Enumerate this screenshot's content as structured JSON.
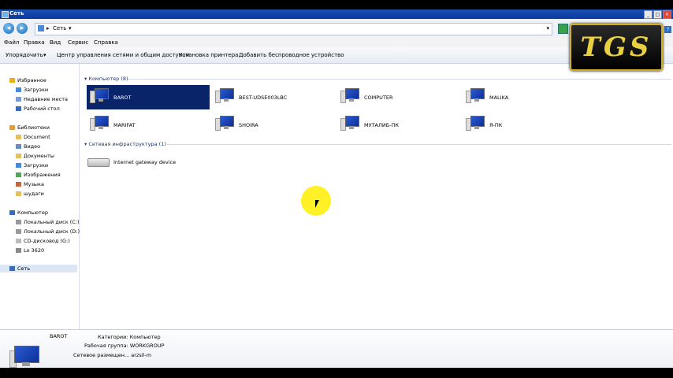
{
  "window": {
    "title": "Сеть"
  },
  "address": {
    "path_root": "Сеть",
    "path_chevron": "▸",
    "dropdown": "▾"
  },
  "menu": [
    "Файл",
    "Правка",
    "Вид",
    "Сервис",
    "Справка"
  ],
  "toolbar": {
    "organize": "Упорядочить",
    "organize_arrow": "▾",
    "items": [
      "Центр управления сетями и общим доступом",
      "Установка принтера",
      "Добавить беспроводное устройство"
    ]
  },
  "sidebar": {
    "favorites": {
      "title": "Избранное",
      "items": [
        "Загрузки",
        "Недавние места",
        "Рабочий стол"
      ]
    },
    "libraries": {
      "title": "Библиотеки",
      "items": [
        "Document",
        "Видео",
        "Документы",
        "Загрузки",
        "Изображения",
        "Музыка",
        "шудаги"
      ]
    },
    "computer": {
      "title": "Компьютер",
      "items": [
        "Локальный диск (C:)",
        "Локальный диск (D:)",
        "CD-дисковод (G:)",
        "Lo 3620"
      ]
    },
    "network": {
      "title": "Сеть"
    }
  },
  "groups": {
    "computers": {
      "title": "Компьютер (8)",
      "items": [
        "BAROT",
        "BEST-UDSE003LBC",
        "COMPUTER",
        "MALIKA",
        "MARIFAT",
        "SHOIRA",
        "МУТАЛИБ-ПК",
        "Я-ПК"
      ]
    },
    "infrastructure": {
      "title": "Сетевая инфраструктура (1)",
      "items": [
        "Internet gateway device"
      ]
    }
  },
  "details": {
    "name": "BAROT",
    "category": "Категории: Компьютер",
    "workgroup": "Рабочая группа: WORKGROUP",
    "location": "Сетевое размещен... arzsil-m"
  },
  "logo": {
    "text": "TGS"
  },
  "colors": {
    "selection": "#0a246a",
    "titlebar": "#1a4fb0",
    "highlight": "#ffee00"
  }
}
